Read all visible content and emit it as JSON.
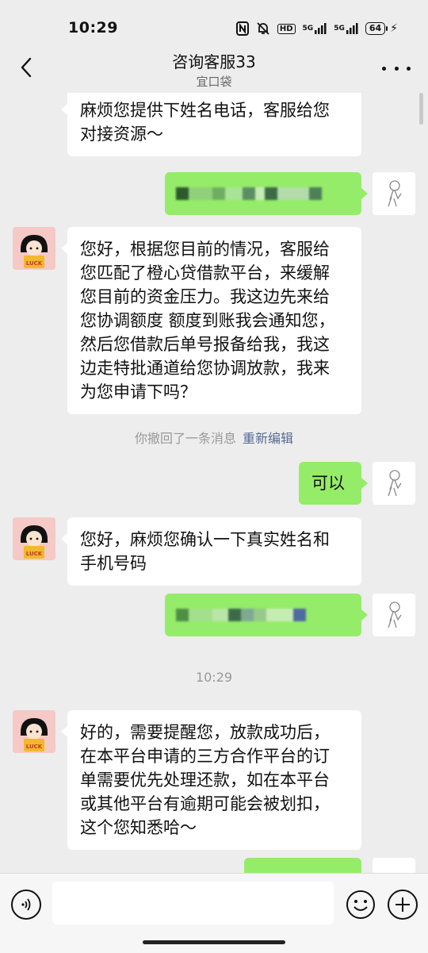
{
  "status_bar": {
    "time": "10:29",
    "battery": "64",
    "network_1": "5G",
    "network_2": "5G",
    "hd": "HD"
  },
  "header": {
    "title": "咨询客服33",
    "subtitle": "宜口袋"
  },
  "messages": [
    {
      "from": "agent",
      "text": "麻烦您提供下姓名电话，客服给您对接资源～",
      "line1": "麻烦您提供下姓名电话，客服给您",
      "line2": "对接资源～"
    },
    {
      "from": "me",
      "text": "",
      "blurred": true
    },
    {
      "from": "agent",
      "lines": [
        "您好，根据您目前的情况，客服给",
        "您匹配了橙心贷借款平台，来缓解",
        "您目前的资金压力。我这边先来给",
        "您协调额度 额度到账我会通知您，",
        "然后您借款后单号报备给我，我这",
        "边走特批通道给您协调放款，我来",
        "为您申请下吗？"
      ]
    },
    {
      "from": "system",
      "text": "你撤回了一条消息",
      "link": "重新编辑"
    },
    {
      "from": "me",
      "text": "可以"
    },
    {
      "from": "agent",
      "lines": [
        "您好，麻烦您确认一下真实姓名和",
        "手机号码"
      ]
    },
    {
      "from": "me",
      "text": "",
      "blurred": true
    },
    {
      "from": "system",
      "text": "10:29"
    },
    {
      "from": "agent",
      "lines": [
        "好的，需要提醒您，放款成功后，",
        "在本平台申请的三方合作平台的订",
        "单需要优先处理还款，如在本平台",
        "或其他平台有逾期可能会被划扣，",
        "这个您知悉哈～"
      ]
    }
  ],
  "avatar_badge": "LUCK",
  "colors": {
    "background": "#ededed",
    "outgoing_bubble": "#95ec69",
    "incoming_bubble": "#ffffff",
    "link": "#576b95"
  },
  "icons": [
    "back-icon",
    "more-icon",
    "voice-icon",
    "emoji-icon",
    "plus-icon"
  ]
}
